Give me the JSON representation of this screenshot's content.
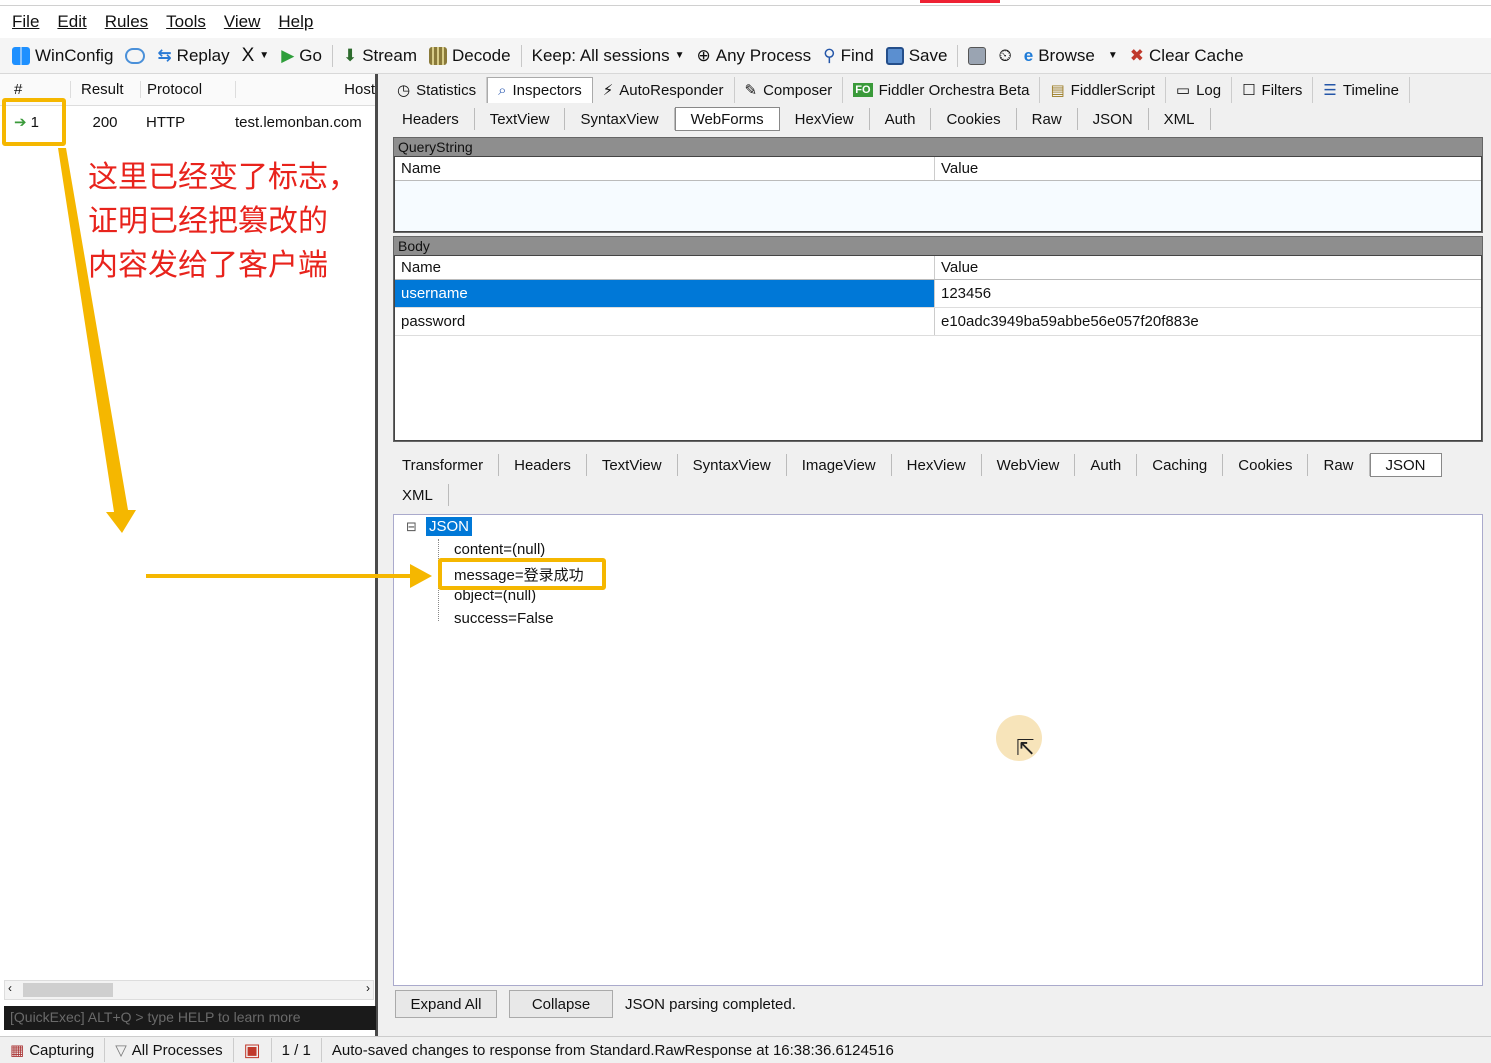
{
  "menu": {
    "items": [
      "File",
      "Edit",
      "Rules",
      "Tools",
      "View",
      "Help"
    ]
  },
  "toolbar": {
    "winconfig": "WinConfig",
    "replay": "Replay",
    "x_label": "X",
    "go": "Go",
    "stream": "Stream",
    "decode": "Decode",
    "keep": "Keep: All sessions",
    "process": "Any Process",
    "find": "Find",
    "save": "Save",
    "browse": "Browse",
    "clear_cache": "Clear Cache"
  },
  "sessions": {
    "headers": {
      "num": "#",
      "result": "Result",
      "protocol": "Protocol",
      "host": "Host"
    },
    "row": {
      "num": "1",
      "result": "200",
      "protocol": "HTTP",
      "host": "test.lemonban.com"
    },
    "quickexec": "[QuickExec] ALT+Q > type HELP to learn more"
  },
  "main_tabs": [
    "Statistics",
    "Inspectors",
    "AutoResponder",
    "Composer",
    "Fiddler Orchestra Beta",
    "FiddlerScript",
    "Log",
    "Filters",
    "Timeline"
  ],
  "request_tabs": [
    "Headers",
    "TextView",
    "SyntaxView",
    "WebForms",
    "HexView",
    "Auth",
    "Cookies",
    "Raw",
    "JSON",
    "XML"
  ],
  "querystring": {
    "caption": "QueryString",
    "name_col": "Name",
    "value_col": "Value"
  },
  "body": {
    "caption": "Body",
    "name_col": "Name",
    "value_col": "Value",
    "rows": [
      {
        "name": "username",
        "value": "123456"
      },
      {
        "name": "password",
        "value": "e10adc3949ba59abbe56e057f20f883e"
      }
    ]
  },
  "response_tabs": [
    "Transformer",
    "Headers",
    "TextView",
    "SyntaxView",
    "ImageView",
    "HexView",
    "WebView",
    "Auth",
    "Caching",
    "Cookies",
    "Raw",
    "JSON",
    "XML"
  ],
  "json_tree": {
    "root": "JSON",
    "children": [
      "content=(null)",
      "message=登录成功",
      "object=(null)",
      "success=False"
    ]
  },
  "bottom": {
    "expand_all": "Expand All",
    "collapse": "Collapse",
    "status": "JSON parsing completed."
  },
  "statusbar": {
    "capturing": "Capturing",
    "processes": "All Processes",
    "count": "1 / 1",
    "message": "Auto-saved changes to response from Standard.RawResponse at 16:38:36.6124516"
  },
  "annotation": {
    "lines": [
      "这里已经变了标志，",
      "证明已经把篡改的",
      "内容发给了客户端"
    ]
  },
  "colors": {
    "annotation_red": "#e8231c",
    "highlight_yellow": "#f5b700",
    "selection_blue": "#0078d7"
  }
}
